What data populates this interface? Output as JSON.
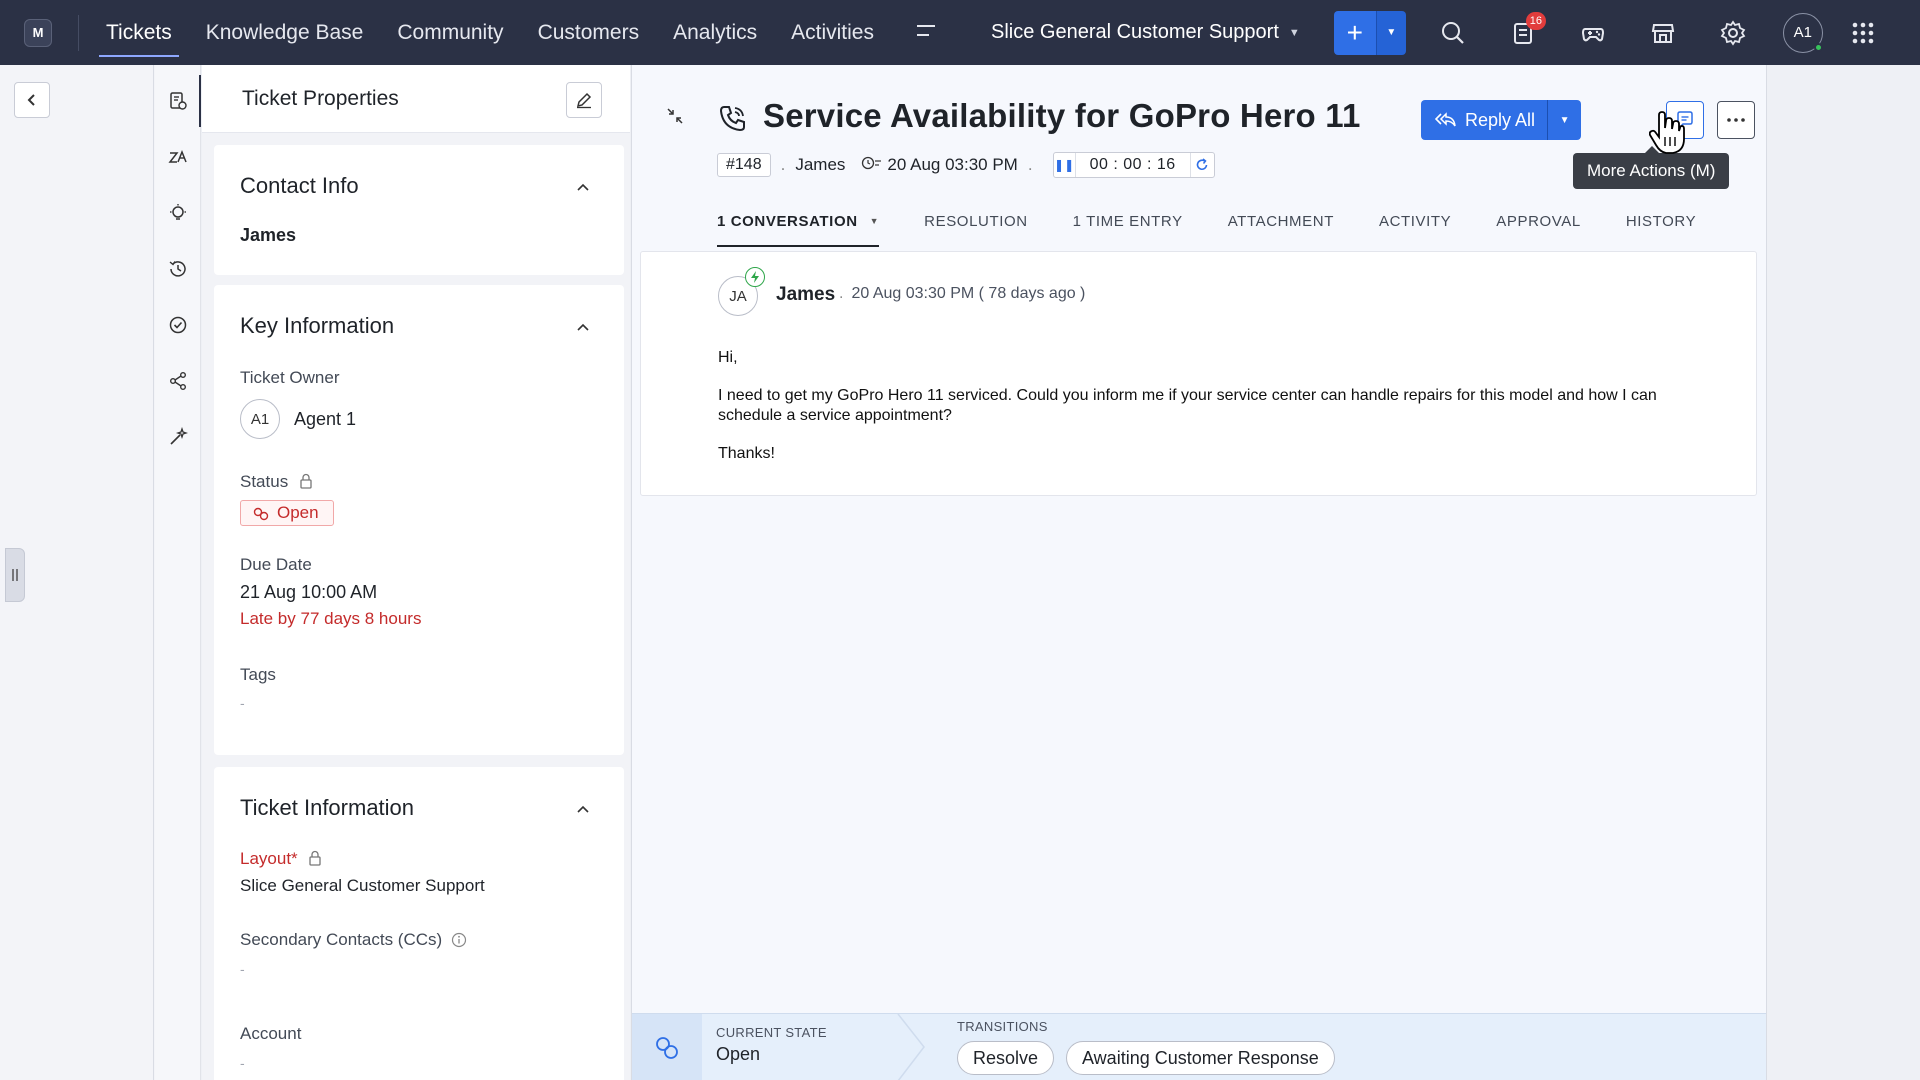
{
  "app": {
    "logo_text": "M",
    "nav_tabs": [
      {
        "label": "Tickets"
      },
      {
        "label": "Knowledge Base"
      },
      {
        "label": "Community"
      },
      {
        "label": "Customers"
      },
      {
        "label": "Analytics"
      },
      {
        "label": "Activities"
      }
    ],
    "department": "Slice General Customer Support",
    "notification_count": "16",
    "user_initials": "A1",
    "online_color": "#37c35b",
    "accent_color": "#2f6fe6",
    "nav_bg_color": "#2b3145"
  },
  "properties": {
    "title": "Ticket Properties",
    "contact": {
      "section_title": "Contact Info",
      "name": "James"
    },
    "key_info": {
      "section_title": "Key Information",
      "owner_label": "Ticket Owner",
      "owner_initials": "A1",
      "owner_name": "Agent 1",
      "status_label": "Status",
      "status_value": "Open",
      "due_label": "Due Date",
      "due_value": "21 Aug 10:00 AM",
      "due_overdue": "Late by 77 days 8 hours",
      "tags_label": "Tags",
      "tags_value": "-"
    },
    "ticket_info": {
      "section_title": "Ticket Information",
      "layout_label": "Layout",
      "layout_required": "*",
      "layout_value": "Slice General Customer Support",
      "cc_label": "Secondary Contacts (CCs)",
      "cc_value": "-",
      "account_label": "Account",
      "account_value": "-"
    }
  },
  "ticket": {
    "title": "Service Availability for GoPro Hero 11",
    "id": "#148",
    "contact": "James",
    "created": "20 Aug 03:30 PM",
    "timer": "00 : 00 : 16",
    "reply_label": "Reply All",
    "tooltip": "More Actions (M)",
    "tabs": [
      {
        "label": "1 CONVERSATION"
      },
      {
        "label": "RESOLUTION"
      },
      {
        "label": "1 TIME ENTRY"
      },
      {
        "label": "ATTACHMENT"
      },
      {
        "label": "ACTIVITY"
      },
      {
        "label": "APPROVAL"
      },
      {
        "label": "HISTORY"
      }
    ]
  },
  "message": {
    "initials": "JA",
    "sender": "James",
    "time": "20 Aug 03:30 PM ( 78 days ago )",
    "greeting": "Hi,",
    "body": "I need to get my GoPro Hero 11 serviced. Could you inform me if your service center can handle repairs for this model and how I can schedule a service appointment?",
    "signoff": "Thanks!"
  },
  "blueprint": {
    "state_label": "CURRENT STATE",
    "state_value": "Open",
    "transitions_label": "TRANSITIONS",
    "transitions": [
      {
        "label": "Resolve"
      },
      {
        "label": "Awaiting Customer Response"
      }
    ]
  }
}
